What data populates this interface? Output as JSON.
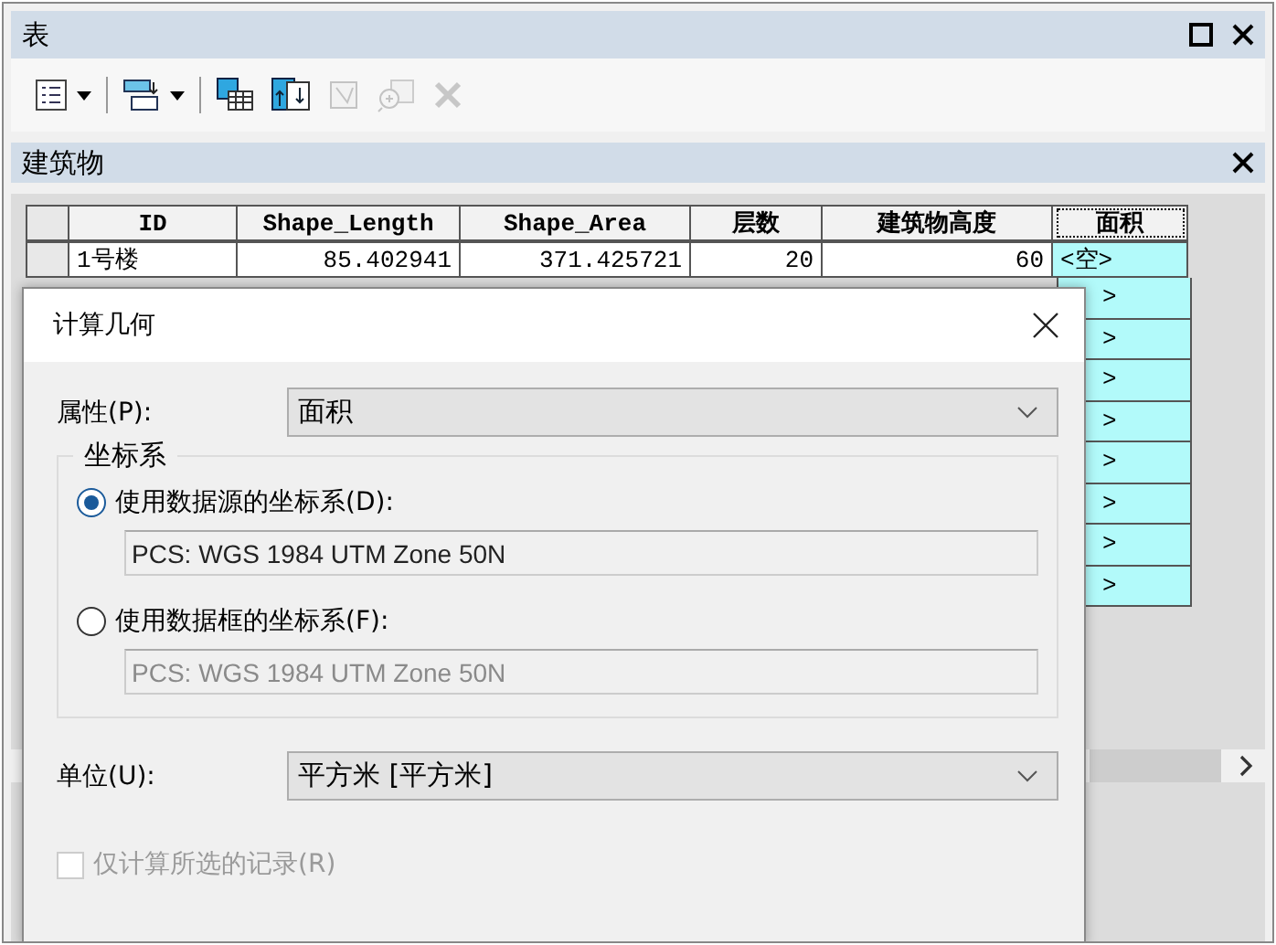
{
  "window": {
    "title": "表"
  },
  "toolbar": [
    {
      "kind": "options",
      "dropdown": true,
      "disabled": false
    },
    {
      "kind": "relate",
      "dropdown": true,
      "disabled": false
    },
    {
      "kind": "select-table",
      "dropdown": false,
      "disabled": false
    },
    {
      "kind": "switch",
      "dropdown": false,
      "disabled": false
    },
    {
      "kind": "clear",
      "dropdown": false,
      "disabled": true
    },
    {
      "kind": "zoom",
      "dropdown": false,
      "disabled": true
    },
    {
      "kind": "delete",
      "dropdown": false,
      "disabled": true
    }
  ],
  "table": {
    "title": "建筑物",
    "columns": [
      "ID",
      "Shape_Length",
      "Shape_Area",
      "层数",
      "建筑物高度",
      "面积"
    ],
    "rows": [
      {
        "cells": [
          "1号楼",
          "85.402941",
          "371.425721",
          "20",
          "60",
          "<空>"
        ]
      }
    ],
    "partial_cells": [
      ">",
      ">",
      ">",
      ">",
      ">",
      ">",
      ">",
      ">"
    ]
  },
  "dialog": {
    "title": "计算几何",
    "property_label": "属性(P):",
    "property_value": "面积",
    "group_title": "坐标系",
    "options": [
      {
        "label": "使用数据源的坐标系(D):",
        "selected": true,
        "value": "PCS: WGS 1984 UTM Zone 50N"
      },
      {
        "label": "使用数据框的坐标系(F):",
        "selected": false,
        "value": "PCS: WGS 1984 UTM Zone 50N"
      }
    ],
    "unit_label": "单位(U):",
    "unit_value": "平方米 [平方米]",
    "checkbox": {
      "label": "仅计算所选的记录(R)",
      "checked": false,
      "disabled": true
    }
  }
}
